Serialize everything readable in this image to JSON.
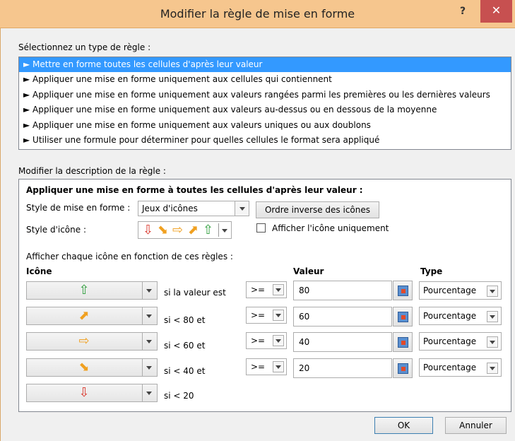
{
  "window": {
    "title": "Modifier la règle de mise en forme",
    "help_label": "?",
    "close_label": "✕"
  },
  "rule_type": {
    "label": "Sélectionnez un type de règle :",
    "items": [
      {
        "label": "► Mettre en forme toutes les cellules d'après leur valeur",
        "selected": true
      },
      {
        "label": "► Appliquer une mise en forme uniquement aux cellules qui contiennent",
        "selected": false
      },
      {
        "label": "► Appliquer une mise en forme uniquement aux valeurs rangées parmi les premières ou les dernières valeurs",
        "selected": false
      },
      {
        "label": "► Appliquer une mise en forme uniquement aux valeurs au-dessus ou en dessous de la moyenne",
        "selected": false
      },
      {
        "label": "► Appliquer une mise en forme uniquement aux valeurs uniques ou aux doublons",
        "selected": false
      },
      {
        "label": "► Utiliser une formule pour déterminer pour quelles cellules le format sera appliqué",
        "selected": false
      }
    ]
  },
  "description": {
    "label": "Modifier la description de la règle :",
    "heading": "Appliquer une mise en forme à toutes les cellules d'après leur valeur :",
    "format_style_label": "Style de mise en forme :",
    "format_style_value": "Jeux d'icônes",
    "reverse_button": "Ordre inverse des icônes",
    "icon_style_label": "Style d'icône :",
    "icon_style_glyphs": [
      "⇩",
      "⬊",
      "⇨",
      "⬈",
      "⇧"
    ],
    "show_icon_only_label": "Afficher l'icône uniquement",
    "show_icon_only_checked": false,
    "rules_caption": "Afficher chaque icône en fonction de ces règles :",
    "col_icon": "Icône",
    "col_value": "Valeur",
    "col_type": "Type",
    "rows": [
      {
        "icon": "⇧",
        "icon_name": "green-up-arrow-icon",
        "condition": "si la valeur est",
        "operator": ">=",
        "value": "80",
        "type": "Pourcentage"
      },
      {
        "icon": "⬈",
        "icon_name": "yellow-up-right-arrow-icon",
        "condition": "si < 80 et",
        "operator": ">=",
        "value": "60",
        "type": "Pourcentage"
      },
      {
        "icon": "⇨",
        "icon_name": "yellow-right-arrow-icon",
        "condition": "si < 60 et",
        "operator": ">=",
        "value": "40",
        "type": "Pourcentage"
      },
      {
        "icon": "⬊",
        "icon_name": "yellow-down-right-arrow-icon",
        "condition": "si < 40 et",
        "operator": ">=",
        "value": "20",
        "type": "Pourcentage"
      },
      {
        "icon": "⇩",
        "icon_name": "red-down-arrow-icon",
        "condition": "si < 20"
      }
    ]
  },
  "footer": {
    "ok_label": "OK",
    "cancel_label": "Annuler"
  },
  "colors": {
    "selection": "#3399ff",
    "close_button": "#c75050",
    "titlebar": "#f6c68e",
    "arrow_green": "#2e9e3c",
    "arrow_yellow": "#f0a020",
    "arrow_red": "#d9362b"
  }
}
